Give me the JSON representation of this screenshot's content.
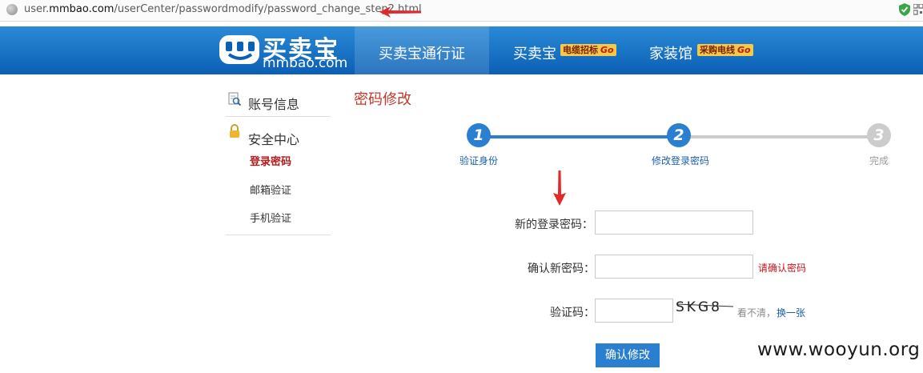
{
  "browser": {
    "url_prefix": "user.",
    "url_domain": "mmbao.com",
    "url_path": "/userCenter/passwordmodify/password_change_step2.html"
  },
  "header": {
    "logo_text": "买卖宝",
    "logo_domain": "mmbao.com",
    "nav": [
      {
        "label": "买卖宝通行证",
        "badge": ""
      },
      {
        "label": "买卖宝",
        "badge": "电缆招标",
        "go": "Go"
      },
      {
        "label": "家装馆",
        "badge": "采购电线",
        "go": "Go"
      }
    ]
  },
  "sidebar": {
    "account_info": "账号信息",
    "security_center": "安全中心",
    "items": [
      {
        "label": "登录密码",
        "active": true
      },
      {
        "label": "邮箱验证",
        "active": false
      },
      {
        "label": "手机验证",
        "active": false
      }
    ]
  },
  "main": {
    "title": "密码修改",
    "steps": [
      {
        "num": "1",
        "label": "验证身份",
        "state": "done"
      },
      {
        "num": "2",
        "label": "修改登录密码",
        "state": "current"
      },
      {
        "num": "3",
        "label": "完成",
        "state": "pending"
      }
    ],
    "form": {
      "new_password_label": "新的登录密码：",
      "confirm_password_label": "确认新密码：",
      "confirm_hint": "请确认密码",
      "captcha_label": "验证码：",
      "captcha_text": "SKG8",
      "captcha_tip": "看不清，",
      "captcha_refresh": "换一张",
      "submit_label": "确认修改"
    }
  },
  "watermark": "www.wooyun.org",
  "colors": {
    "header_blue": "#0b5fb5",
    "accent_red": "#c0392b",
    "step_blue": "#2b7fd1",
    "step_gray": "#cccccc",
    "annotation_red": "#e02a2a"
  }
}
